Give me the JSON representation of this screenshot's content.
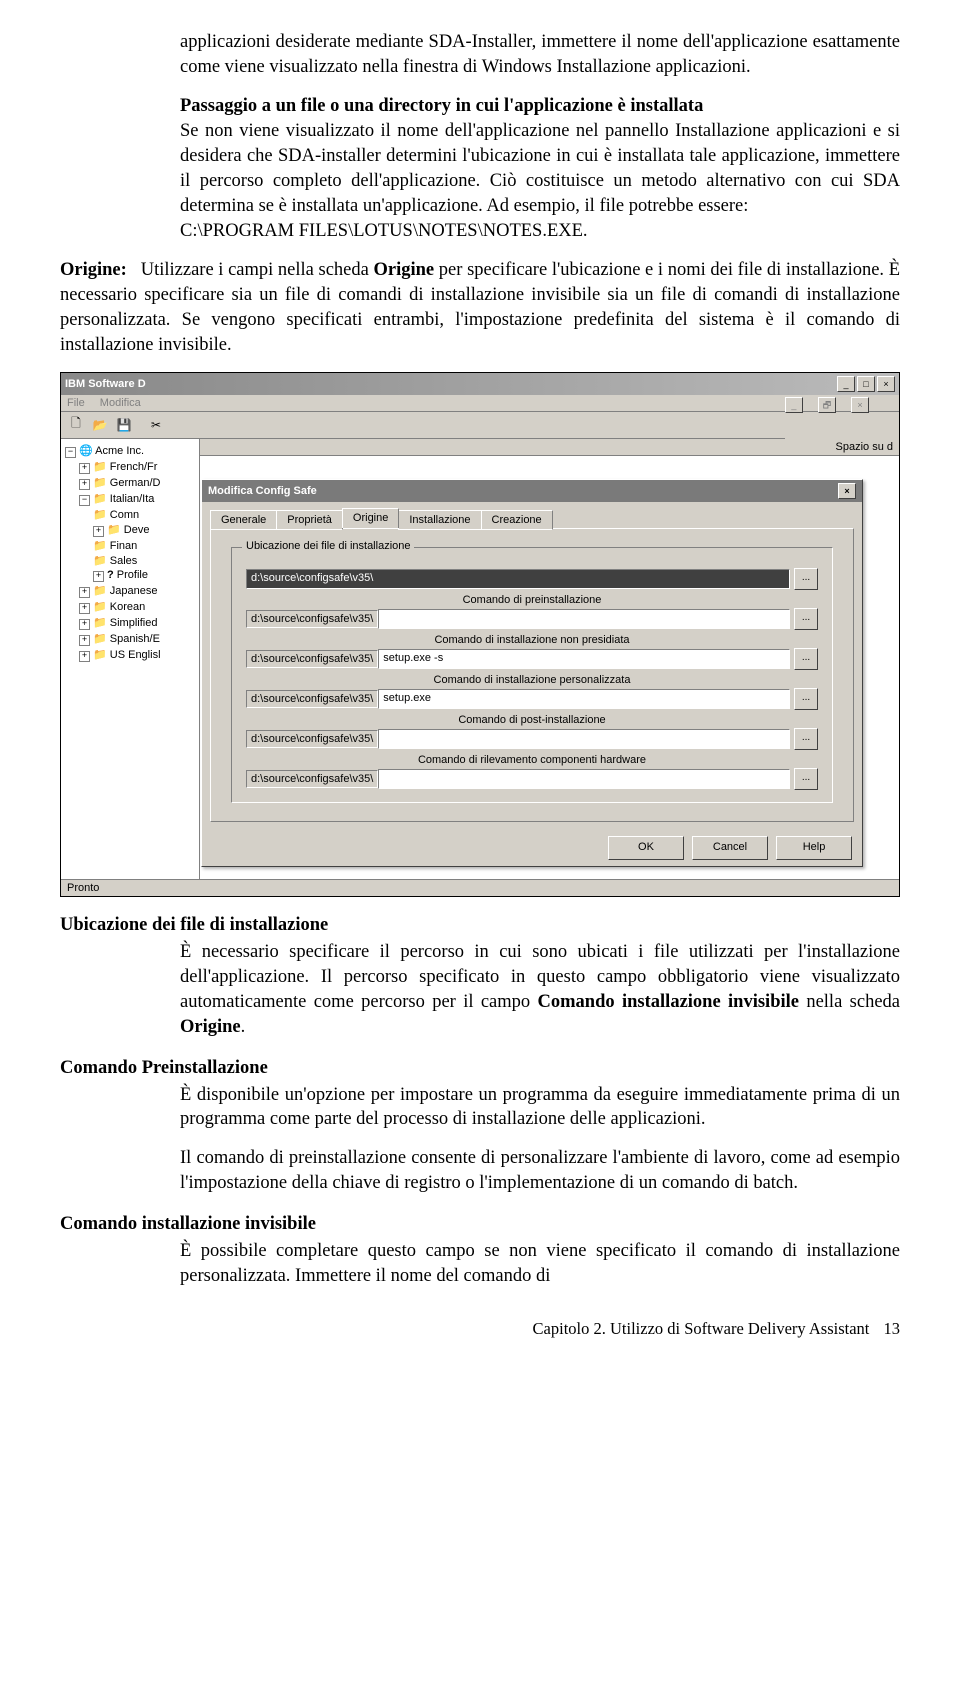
{
  "para1": "applicazioni desiderate mediante SDA-Installer, immettere il nome dell'applicazione esattamente come viene visualizzato nella finestra di Windows Installazione applicazioni.",
  "para2_bold": "Passaggio a un file o una directory in cui l'applicazione è installata",
  "para2_rest": "Se non viene visualizzato il nome dell'applicazione nel pannello Installazione applicazioni e si desidera che SDA-installer determini l'ubicazione in cui è installata tale applicazione, immettere il percorso completo dell'applicazione. Ciò costituisce un metodo alternativo con cui SDA determina se è installata un'applicazione. Ad esempio, il file potrebbe essere:",
  "para2_path": "C:\\PROGRAM FILES\\LOTUS\\NOTES\\NOTES.EXE.",
  "origine_label": "Origine:",
  "origine_text1": "Utilizzare i campi nella scheda ",
  "origine_bold": "Origine",
  "origine_text2": " per specificare l'ubicazione e i nomi dei file di installazione. È necessario specificare sia un file di comandi di installazione invisibile sia un file di comandi di installazione personalizzata. Se vengono specificati entrambi, l'impostazione predefinita del sistema è il comando di installazione invisibile.",
  "ibm_title": "IBM Software D",
  "menu_file": "File",
  "menu_mod": "Modifica",
  "spazio": "Spazio su d",
  "tree": {
    "root": "Acme Inc.",
    "items": [
      "French/Fr",
      "German/D",
      "Italian/Ita",
      "Japanese",
      "Korean",
      "Simplified",
      "Spanish/E",
      "US Englisl"
    ],
    "sub": [
      "Comn",
      "Deve",
      "Finan",
      "Sales",
      "Profile"
    ]
  },
  "dialog_title": "Modifica Config Safe",
  "tabs": [
    "Generale",
    "Proprietà",
    "Origine",
    "Installazione",
    "Creazione"
  ],
  "group_label": "Ubicazione dei file di installazione",
  "path_prefix": "d:\\source\\configsafe\\v35\\",
  "labels": {
    "pre": "Comando di preinstallazione",
    "unatt": "Comando di installazione non presidiata",
    "pers": "Comando di installazione personalizzata",
    "post": "Comando di post-installazione",
    "hw": "Comando di rilevamento componenti hardware"
  },
  "vals": {
    "unatt": "setup.exe -s",
    "pers": "setup.exe"
  },
  "btns": {
    "ok": "OK",
    "cancel": "Cancel",
    "help": "Help"
  },
  "status": "Pronto",
  "sec1_title": "Ubicazione dei file di installazione",
  "sec1_p1": "È necessario specificare il percorso in cui sono ubicati i file utilizzati per l'installazione dell'applicazione. Il percorso specificato in questo campo obbligatorio viene visualizzato automaticamente come percorso per il campo ",
  "sec1_b": "Comando installazione invisibile",
  "sec1_p2": " nella scheda ",
  "sec1_b2": "Origine",
  "sec1_p3": ".",
  "sec2_title": "Comando Preinstallazione",
  "sec2_p": "È disponibile un'opzione per impostare un programma da eseguire immediatamente prima di un programma come parte del processo di installazione delle applicazioni.",
  "sec2_p2": "Il comando di preinstallazione consente di personalizzare l'ambiente di lavoro, come ad esempio l'impostazione della chiave di registro o l'implementazione di un comando di batch.",
  "sec3_title": "Comando installazione invisibile",
  "sec3_p": "È possibile completare questo campo se non viene specificato il comando di installazione personalizzata. Immettere il nome del comando di",
  "footer_chapter": "Capitolo 2. Utilizzo di Software Delivery Assistant",
  "footer_page": "13"
}
